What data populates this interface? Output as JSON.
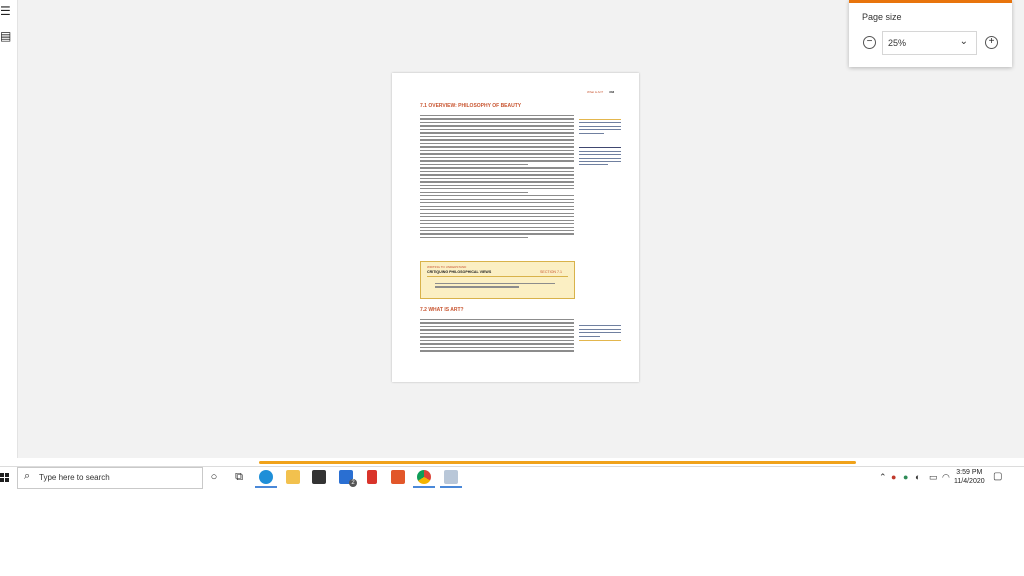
{
  "popup": {
    "title": "Page size",
    "zoom_value": "25%",
    "minus_label": "−",
    "plus_label": "+",
    "accent_color": "#e8740c"
  },
  "document": {
    "running_header": "What is Art?",
    "page_number": "333",
    "section1_title": "7.1 OVERVIEW: PHILOSOPHY OF BEAUTY",
    "callout_kicker": "WRITING TO UNDERSTAND",
    "callout_title": "CRITIQUING PHILOSOPHICAL VIEWS",
    "callout_section": "SECTION 7.1",
    "section2_title": "7.2 WHAT IS ART?",
    "accent_color": "#c8542f"
  },
  "viewer": {
    "scroll_position_fraction": 0.78,
    "scroll_color": "#f0a21a"
  },
  "taskbar": {
    "search_placeholder": "Type here to search",
    "clock_time": "3:59 PM",
    "clock_date": "11/4/2020",
    "mail_badge": "2",
    "icons": [
      "start-icon",
      "search-icon",
      "cortana-icon",
      "task-view-icon",
      "edge-icon",
      "file-explorer-icon",
      "store-icon",
      "mail-icon",
      "gift-icon",
      "office-icon",
      "chrome-icon",
      "paint-icon"
    ]
  }
}
